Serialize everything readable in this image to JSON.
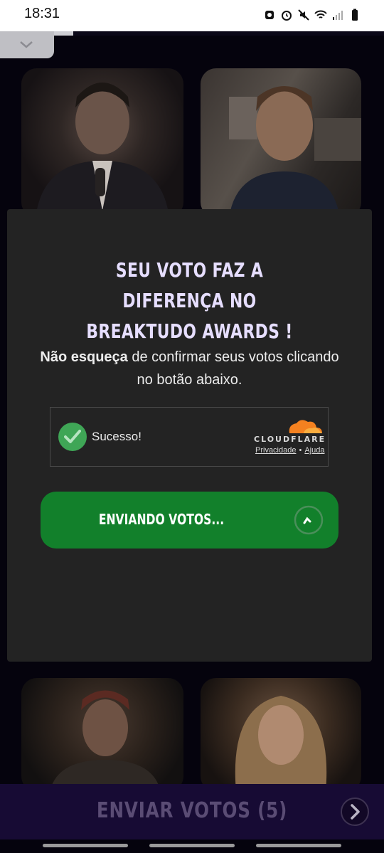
{
  "status_bar": {
    "time": "18:31"
  },
  "voting_progress": {
    "fraction": 0.19
  },
  "modal": {
    "title_line1": "SEU VOTO FAZ A DIFERENÇA NO",
    "title_line2": "BREAKTUDO AWARDS !",
    "text_bold": "Não esqueça",
    "text_rest": " de confirmar seus votos clicando no botão abaixo."
  },
  "captcha": {
    "status": "Sucesso!",
    "brand": "CLOUDFLARE",
    "privacy_link": "Privacidade",
    "separator": "•",
    "help_link": "Ajuda"
  },
  "send_button": {
    "label": "ENVIANDO VOTOS..."
  },
  "bottom_bar": {
    "label": "ENVIAR VOTOS (5)"
  },
  "colors": {
    "accent_green": "#12802b",
    "title_lavender": "#e6deff",
    "bottom_bar_bg": "#170b34",
    "cloudflare_orange": "#f48120"
  }
}
